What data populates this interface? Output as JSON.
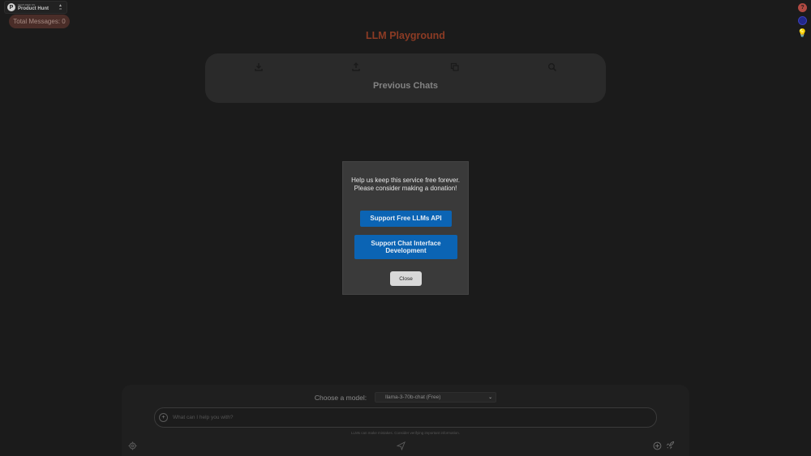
{
  "product_hunt": {
    "small_text": "FEATURED ON",
    "name": "Product Hunt",
    "vote_count": "45"
  },
  "total_messages": "Total Messages: 0",
  "app_title": "LLM Playground",
  "chats_panel": {
    "title": "Previous Chats",
    "icons": [
      "download-icon",
      "upload-icon",
      "copy-icon",
      "search-icon"
    ]
  },
  "modal": {
    "message": "Help us keep this service free forever. Please consider making a donation!",
    "support_api_label": "Support Free LLMs API",
    "support_dev_label": "Support Chat Interface Development",
    "close_label": "Close"
  },
  "bottom": {
    "model_label": "Choose a model:",
    "model_selected": "llama-3-70b-chat (Free)",
    "input_placeholder": "What can I help you with?",
    "disclaimer": "LLMs can make mistakes. Consider verifying important information."
  },
  "colors": {
    "background": "#1b1b1b",
    "title": "#8c3b24",
    "primary_button": "#0b64b4",
    "modal": "#3a3a3a"
  }
}
